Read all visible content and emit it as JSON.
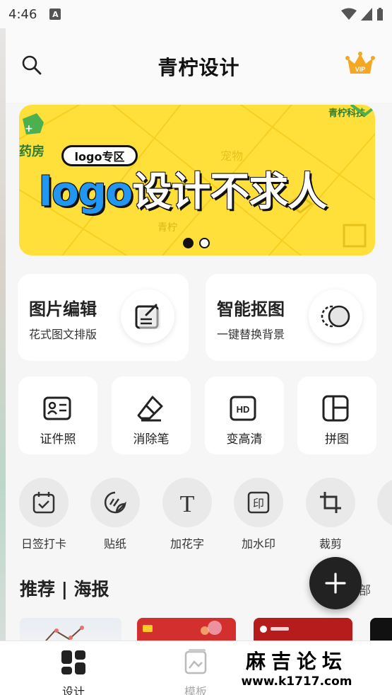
{
  "status_bar": {
    "time": "4:46",
    "indicator": "A"
  },
  "header": {
    "title": "青柠设计",
    "vip_badge": "VIP"
  },
  "banner": {
    "tag": "logo专区",
    "headline_en": "logo",
    "headline_cn": "设计不求人",
    "pattern_texts": [
      "药房",
      "青柠科技",
      "宠物",
      "青柠"
    ],
    "page_count": 2,
    "active_page": 1
  },
  "features": [
    {
      "title": "图片编辑",
      "subtitle": "花式图文排版",
      "icon": "edit-note-icon"
    },
    {
      "title": "智能抠图",
      "subtitle": "一键替换背景",
      "icon": "cutout-circles-icon"
    }
  ],
  "tools": [
    {
      "label": "证件照",
      "icon": "id-card-icon"
    },
    {
      "label": "消除笔",
      "icon": "eraser-icon"
    },
    {
      "label": "变高清",
      "icon": "hd-icon"
    },
    {
      "label": "拼图",
      "icon": "collage-icon"
    }
  ],
  "mini_tools": [
    {
      "label": "日签打卡",
      "icon": "calendar-check-icon"
    },
    {
      "label": "贴纸",
      "icon": "sticker-icon"
    },
    {
      "label": "加花字",
      "icon": "text-t-icon"
    },
    {
      "label": "加水印",
      "icon": "watermark-stamp-icon"
    },
    {
      "label": "裁剪",
      "icon": "crop-icon"
    }
  ],
  "section": {
    "title": "推荐 | 海报",
    "more": "部"
  },
  "fab": {
    "icon": "plus-icon"
  },
  "bottom_nav": [
    {
      "label": "设计",
      "icon": "grid-design-icon",
      "active": true
    },
    {
      "label": "模板",
      "icon": "template-icon",
      "active": false
    }
  ],
  "watermark": {
    "name": "麻吉论坛",
    "url": "www.k1717.com"
  },
  "colors": {
    "banner_bg": "#ffe03a",
    "accent_blue": "#2196f3",
    "vip_orange": "#f5a623",
    "fab_bg": "#222222"
  }
}
